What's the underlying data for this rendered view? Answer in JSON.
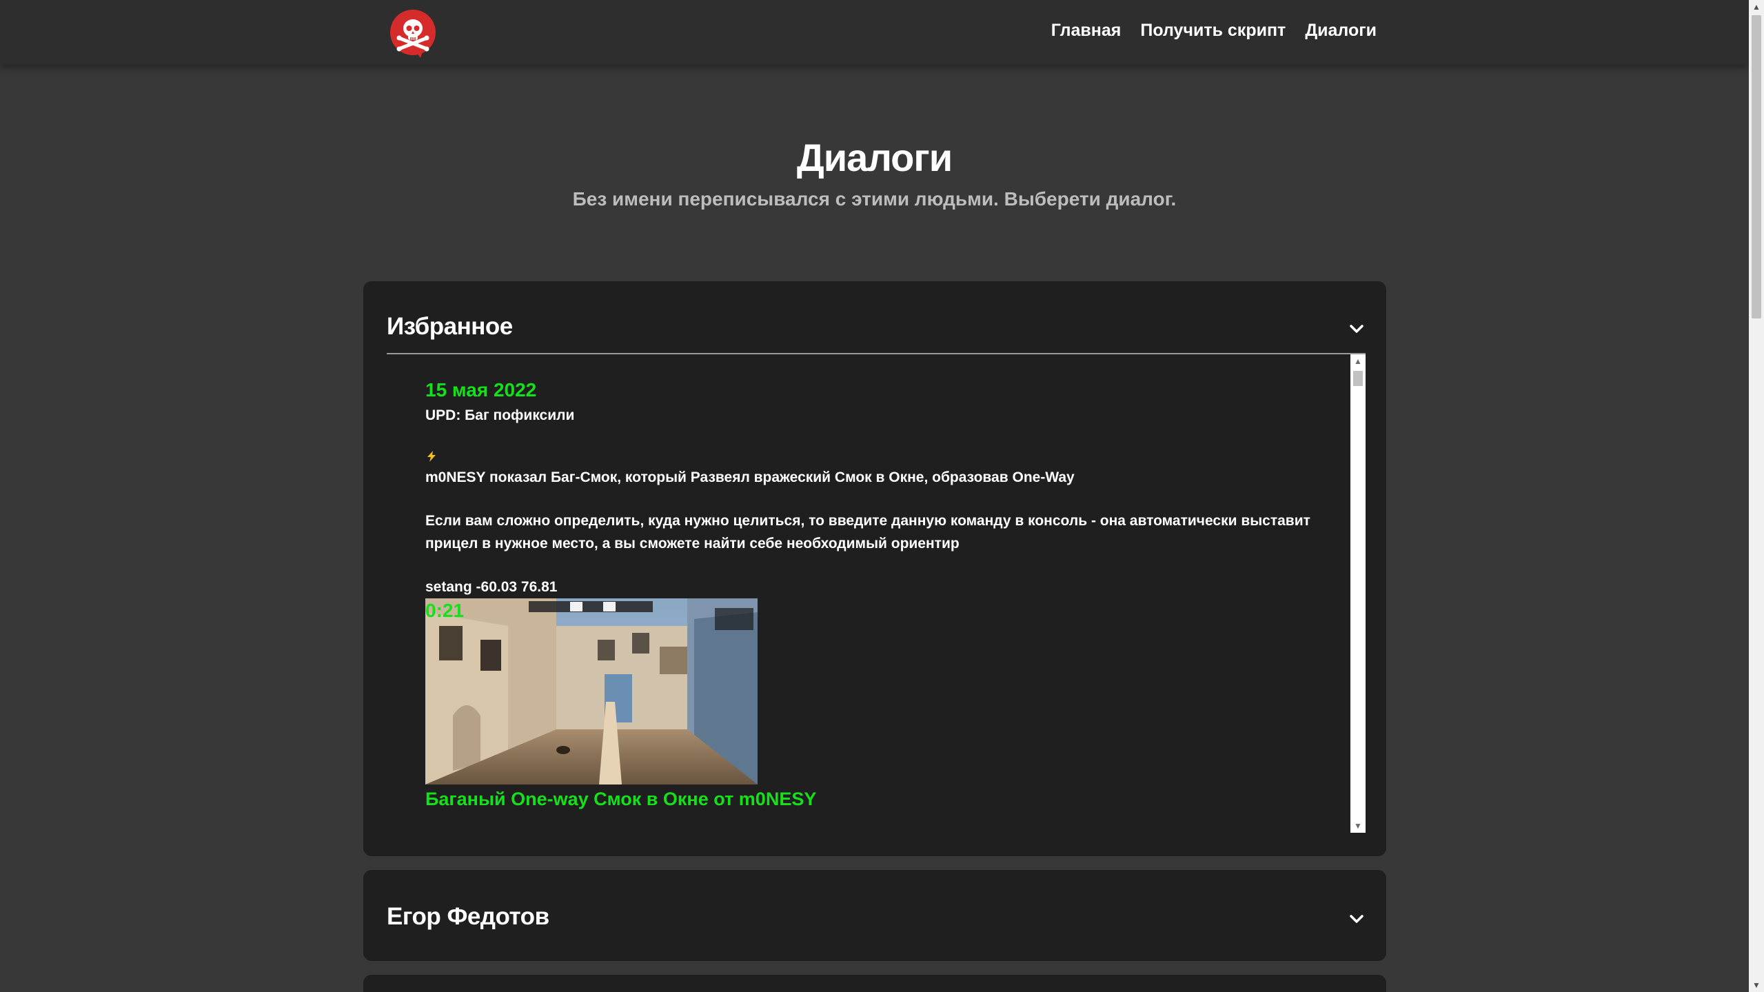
{
  "header": {
    "logo_icon": "skull-crossbones-icon",
    "nav": [
      "Главная",
      "Получить скрипт",
      "Диалоги"
    ]
  },
  "hero": {
    "title": "Диалоги",
    "subtitle": "Без имени переписывался с этими людьми. Выберети диалог."
  },
  "dialogs": [
    {
      "name": "Избранное",
      "expanded": true,
      "post": {
        "date": "15 мая 2022",
        "lines": [
          "UPD: Баг пофиксили",
          "m0NESY показал Баг-Смок, который Развеял вражеский Смок в Окне, образовав One-Way",
          "Если вам сложно определить, куда нужно целиться, то введите данную команду в консоль - она автоматически выставит прицел в нужное место, а вы сможете найти себе необходимый ориентир",
          "setang -60.03 76.81"
        ],
        "video": {
          "duration": "0:21",
          "title": "Баганый One-way Смок в Окне от m0NESY"
        }
      }
    },
    {
      "name": "Егор Федотов",
      "expanded": false
    }
  ],
  "colors": {
    "accent_green": "#16e01c",
    "panel_bg": "#1f1f1f",
    "page_bg": "#383838",
    "logo_red": "#d62b2b"
  }
}
